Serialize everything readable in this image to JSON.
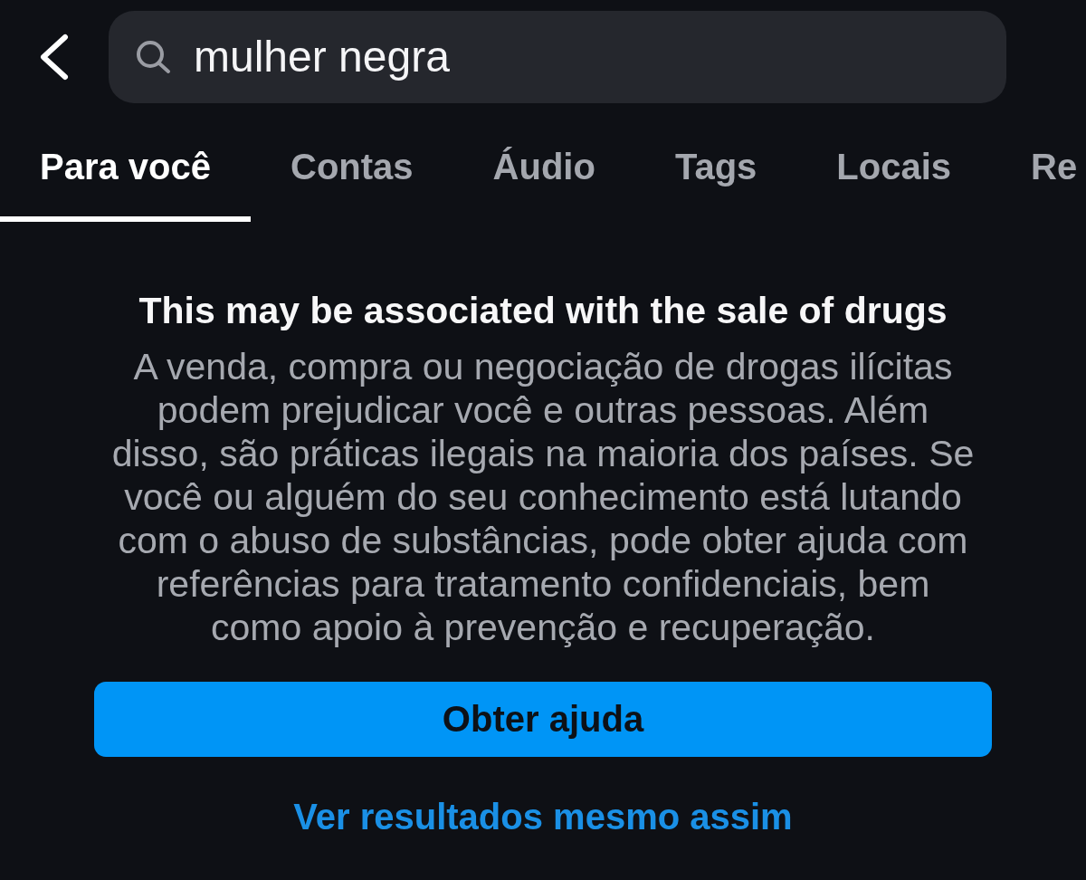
{
  "search": {
    "value": "mulher negra"
  },
  "tabs": [
    {
      "label": "Para você",
      "selected": true
    },
    {
      "label": "Contas",
      "selected": false
    },
    {
      "label": "Áudio",
      "selected": false
    },
    {
      "label": "Tags",
      "selected": false
    },
    {
      "label": "Locais",
      "selected": false
    },
    {
      "label": "Re",
      "selected": false
    }
  ],
  "warning": {
    "title": "This may be associated with the sale of drugs",
    "body": "A venda, compra ou negociação de drogas ilícitas podem prejudicar você e outras pessoas. Além disso, são práticas ilegais na maioria dos países. Se você ou alguém do seu conhecimento está lutando com o abuso de substâncias, pode obter ajuda com referências para tratamento confidenciais, bem como apoio à prevenção e recuperação.",
    "primary_button": "Obter ajuda",
    "secondary_link": "Ver resultados mesmo assim"
  }
}
